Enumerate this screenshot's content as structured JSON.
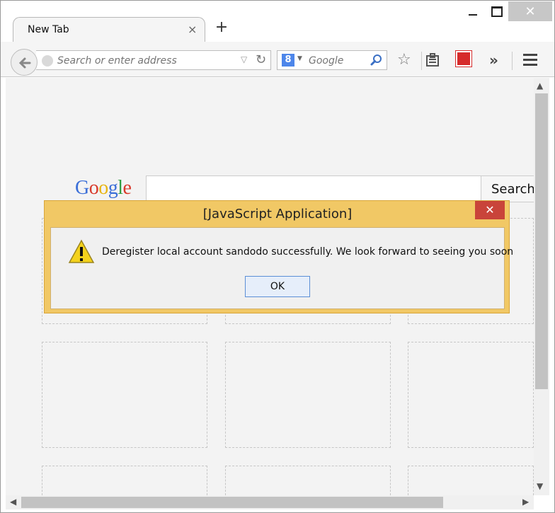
{
  "window": {
    "close_glyph": "✕"
  },
  "tabs": [
    {
      "title": "New Tab",
      "close_glyph": "×"
    }
  ],
  "new_tab_glyph": "+",
  "toolbar": {
    "address_placeholder": "Search or enter address",
    "search_engine": "Google",
    "search_engine_letter": "8",
    "overflow_glyph": "»"
  },
  "page": {
    "logo_letters": [
      "G",
      "o",
      "o",
      "g",
      "l",
      "e"
    ],
    "logo_colors": [
      "#3b6fd8",
      "#d8392b",
      "#e8b512",
      "#3b6fd8",
      "#2f9e44",
      "#d8392b"
    ],
    "search_button": "Search"
  },
  "dialog": {
    "title": "[JavaScript Application]",
    "close_glyph": "✕",
    "message": "Deregister local account sandodo successfully. We look forward to seeing you soon",
    "ok_label": "OK"
  },
  "colors": {
    "dialog_frame": "#f1c865",
    "dialog_close": "#c9443a",
    "ok_border": "#5c8fd6"
  }
}
